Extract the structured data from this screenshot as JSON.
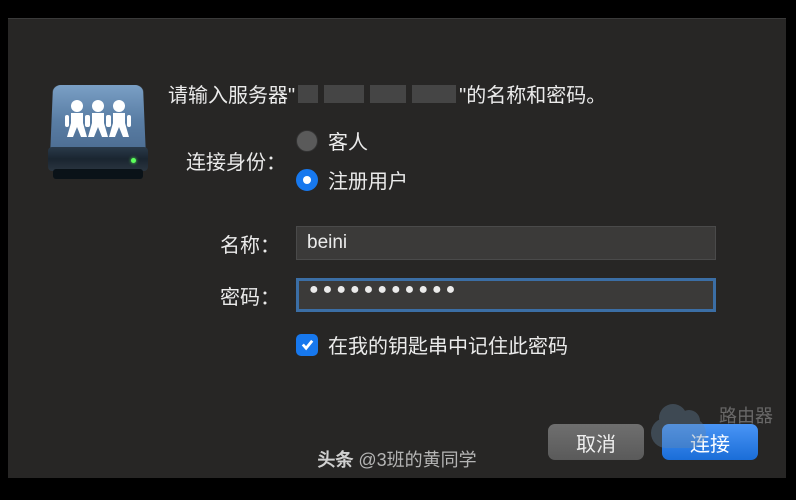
{
  "prompt": {
    "prefix": "请输入服务器\"",
    "suffix": "\"的名称和密码。"
  },
  "connect_as": {
    "label": "连接身份：",
    "options": {
      "guest": "客人",
      "registered": "注册用户"
    },
    "selected": "registered"
  },
  "fields": {
    "name_label": "名称：",
    "name_value": "beini",
    "password_label": "密码：",
    "password_mask": "●●●●●●●●●●●"
  },
  "remember": {
    "label": "在我的钥匙串中记住此密码",
    "checked": true
  },
  "buttons": {
    "cancel": "取消",
    "connect": "连接"
  },
  "watermark": {
    "brand": "路由器",
    "attribution_prefix": "头条 ",
    "attribution_handle": "@3班的黄同学"
  }
}
